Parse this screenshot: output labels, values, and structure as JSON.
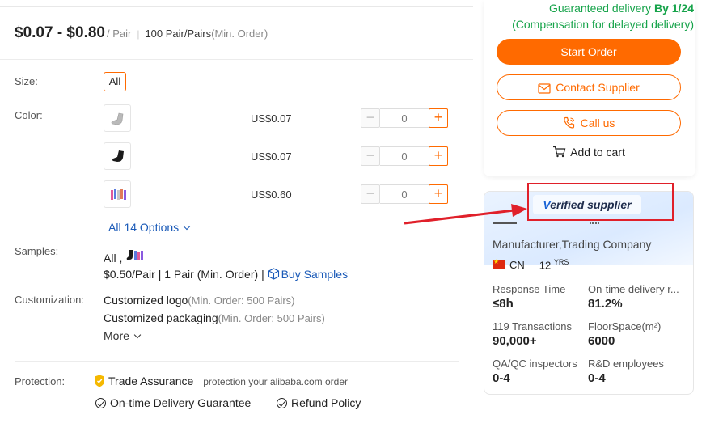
{
  "price": {
    "range": "$0.07 - $0.80",
    "unit": "/ Pair",
    "moq": "100 Pair/Pairs",
    "moq_note": "(Min. Order)"
  },
  "size": {
    "label": "Size:",
    "option": "All"
  },
  "color": {
    "label": "Color:",
    "items": [
      {
        "price": "US$0.07",
        "qty": "0"
      },
      {
        "price": "US$0.07",
        "qty": "0"
      },
      {
        "price": "US$0.60",
        "qty": "0"
      }
    ],
    "all_options": "All 14 Options"
  },
  "samples": {
    "label": "Samples:",
    "value": "All ,",
    "price": "$0.50/Pair",
    "moq": "1 Pair (Min. Order)",
    "sep": "|",
    "buy_link": "Buy Samples"
  },
  "customization": {
    "label": "Customization:",
    "logo": "Customized logo",
    "logo_note": "(Min. Order: 500 Pairs)",
    "packaging": "Customized packaging",
    "packaging_note": "(Min. Order: 500 Pairs)",
    "more": "More"
  },
  "protection": {
    "label": "Protection:",
    "trade_assurance": "Trade Assurance",
    "trade_note": "protection your alibaba.com order",
    "delivery": "On-time Delivery Guarantee",
    "refund": "Refund Policy"
  },
  "order": {
    "guarantee_text": "Guaranteed delivery",
    "guarantee_date": "By 1/24",
    "compensation": "(Compensation for delayed delivery)",
    "start_order": "Start Order",
    "contact_supplier": "Contact Supplier",
    "call_us": "Call us",
    "add_to_cart": "Add to cart"
  },
  "supplier": {
    "verified_v": "V",
    "verified_rest": "erified supplier",
    "business_type": "Manufacturer,Trading Company",
    "country": "CN",
    "years": "12",
    "years_unit": "YRS",
    "stats": [
      {
        "label": "Response Time",
        "value": "≤8h"
      },
      {
        "label": "On-time delivery r...",
        "value": "81.2%"
      },
      {
        "label": "119 Transactions",
        "value": "90,000+"
      },
      {
        "label": "FloorSpace(m²)",
        "value": "6000"
      },
      {
        "label": "QA/QC inspectors",
        "value": "0-4"
      },
      {
        "label": "R&D employees",
        "value": "0-4"
      }
    ]
  },
  "colors": {
    "accent": "#ff6a00",
    "link": "#1a5ab8",
    "green": "#16a34a",
    "annotation": "#e0202a"
  }
}
